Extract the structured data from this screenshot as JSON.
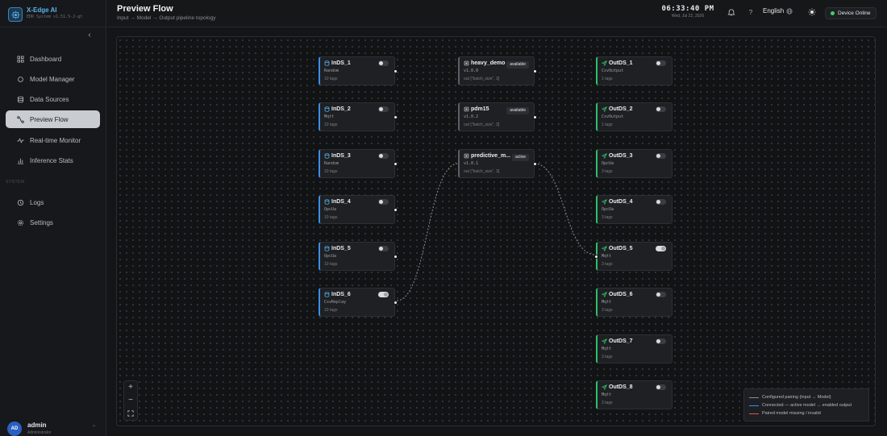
{
  "app": {
    "name": "X-Edge AI",
    "subtitle": "EDR System v1.51.5-2-gt"
  },
  "header": {
    "title": "Preview Flow",
    "subtitle": "Input → Model → Output pipeline topology",
    "time": "06:33:40 PM",
    "date": "Wed, Jul 22, 2026",
    "language": "English",
    "device_status": "Device Online",
    "help": "?"
  },
  "sidebar": {
    "items": [
      {
        "label": "Dashboard",
        "icon": "grid-icon"
      },
      {
        "label": "Model Manager",
        "icon": "circle-icon"
      },
      {
        "label": "Data Sources",
        "icon": "database-icon"
      },
      {
        "label": "Preview Flow",
        "icon": "flow-icon",
        "active": true
      },
      {
        "label": "Real-time Monitor",
        "icon": "pulse-icon"
      },
      {
        "label": "Inference Stats",
        "icon": "bar-chart-icon"
      }
    ],
    "section_label": "SYSTEM",
    "system_items": [
      {
        "label": "Logs",
        "icon": "clock-icon"
      },
      {
        "label": "Settings",
        "icon": "gear-icon"
      }
    ]
  },
  "user": {
    "initials": "AD",
    "name": "admin",
    "role": "Administrator"
  },
  "flow": {
    "inputs": [
      {
        "name": "InDS_1",
        "type": "Random",
        "tags": "10 tags",
        "enabled": false
      },
      {
        "name": "InDS_2",
        "type": "Mqtt",
        "tags": "10 tags",
        "enabled": false
      },
      {
        "name": "InDS_3",
        "type": "Random",
        "tags": "10 tags",
        "enabled": false
      },
      {
        "name": "InDS_4",
        "type": "OpcUa",
        "tags": "10 tags",
        "enabled": false
      },
      {
        "name": "InDS_5",
        "type": "OpcUa",
        "tags": "10 tags",
        "enabled": false
      },
      {
        "name": "InDS_6",
        "type": "CsvReplay",
        "tags": "10 tags",
        "enabled": true
      }
    ],
    "models": [
      {
        "name": "heavy_demo",
        "version": "v1.0.0",
        "status": "available",
        "out": "out [\"batch_size\", 3]"
      },
      {
        "name": "pdm15",
        "version": "v1.0.2",
        "status": "available",
        "out": "out [\"batch_size\", 3]"
      },
      {
        "name": "predictive_m...",
        "version": "v1.0.1",
        "status": "active",
        "out": "out [\"batch_size\", 3]"
      }
    ],
    "outputs": [
      {
        "name": "OutDS_1",
        "type": "CsvOutput",
        "tags": "1 tags",
        "enabled": false
      },
      {
        "name": "OutDS_2",
        "type": "CsvOutput",
        "tags": "1 tags",
        "enabled": false
      },
      {
        "name": "OutDS_3",
        "type": "OpcUa",
        "tags": "3 tags",
        "enabled": false
      },
      {
        "name": "OutDS_4",
        "type": "OpcUa",
        "tags": "3 tags",
        "enabled": false
      },
      {
        "name": "OutDS_5",
        "type": "Mqtt",
        "tags": "3 tags",
        "enabled": true
      },
      {
        "name": "OutDS_6",
        "type": "Mqtt",
        "tags": "3 tags",
        "enabled": false
      },
      {
        "name": "OutDS_7",
        "type": "Mqtt",
        "tags": "3 tags",
        "enabled": false
      },
      {
        "name": "OutDS_8",
        "type": "Mqtt",
        "tags": "3 tags",
        "enabled": false
      }
    ]
  },
  "legend": [
    {
      "label": "Configured pairing (input → Model)",
      "color": "#8a8e94"
    },
    {
      "label": "Connected — active model → enabled output",
      "color": "#3a8ee6"
    },
    {
      "label": "Paired model missing / invalid",
      "color": "#e05555"
    }
  ],
  "colors": {
    "accent": "#5cb4ef",
    "input_accent": "#3a8ee6",
    "output_accent": "#2fbf6a",
    "online": "#3ecf6b"
  }
}
